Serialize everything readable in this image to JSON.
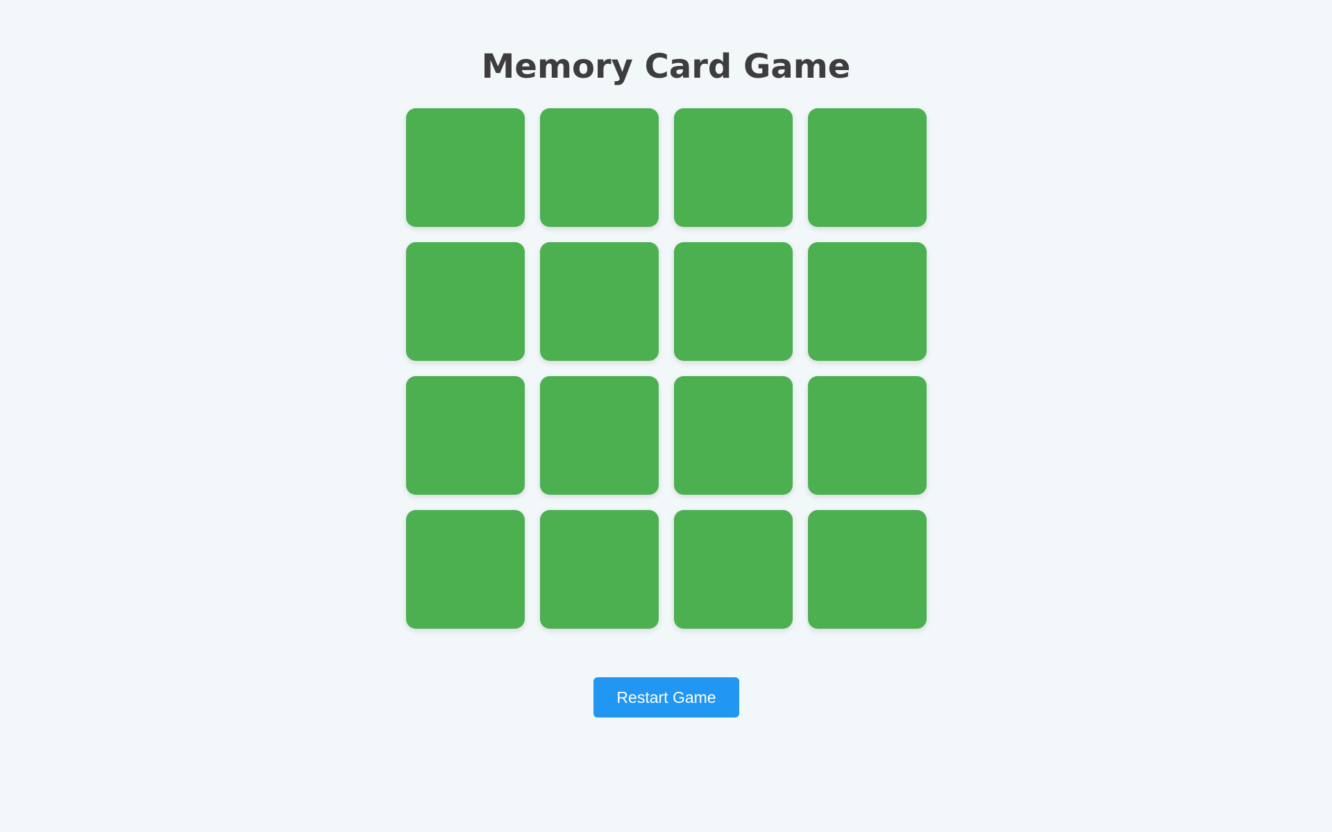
{
  "game": {
    "title": "Memory Card Game",
    "restart_label": "Restart Game",
    "grid_rows": 4,
    "grid_cols": 4,
    "cards": [
      {
        "state": "face-down"
      },
      {
        "state": "face-down"
      },
      {
        "state": "face-down"
      },
      {
        "state": "face-down"
      },
      {
        "state": "face-down"
      },
      {
        "state": "face-down"
      },
      {
        "state": "face-down"
      },
      {
        "state": "face-down"
      },
      {
        "state": "face-down"
      },
      {
        "state": "face-down"
      },
      {
        "state": "face-down"
      },
      {
        "state": "face-down"
      },
      {
        "state": "face-down"
      },
      {
        "state": "face-down"
      },
      {
        "state": "face-down"
      },
      {
        "state": "face-down"
      }
    ]
  },
  "colors": {
    "card_back": "#4caf50",
    "button": "#2196f3",
    "title_text": "#3d3d3d",
    "background": "#f2f7f9"
  }
}
